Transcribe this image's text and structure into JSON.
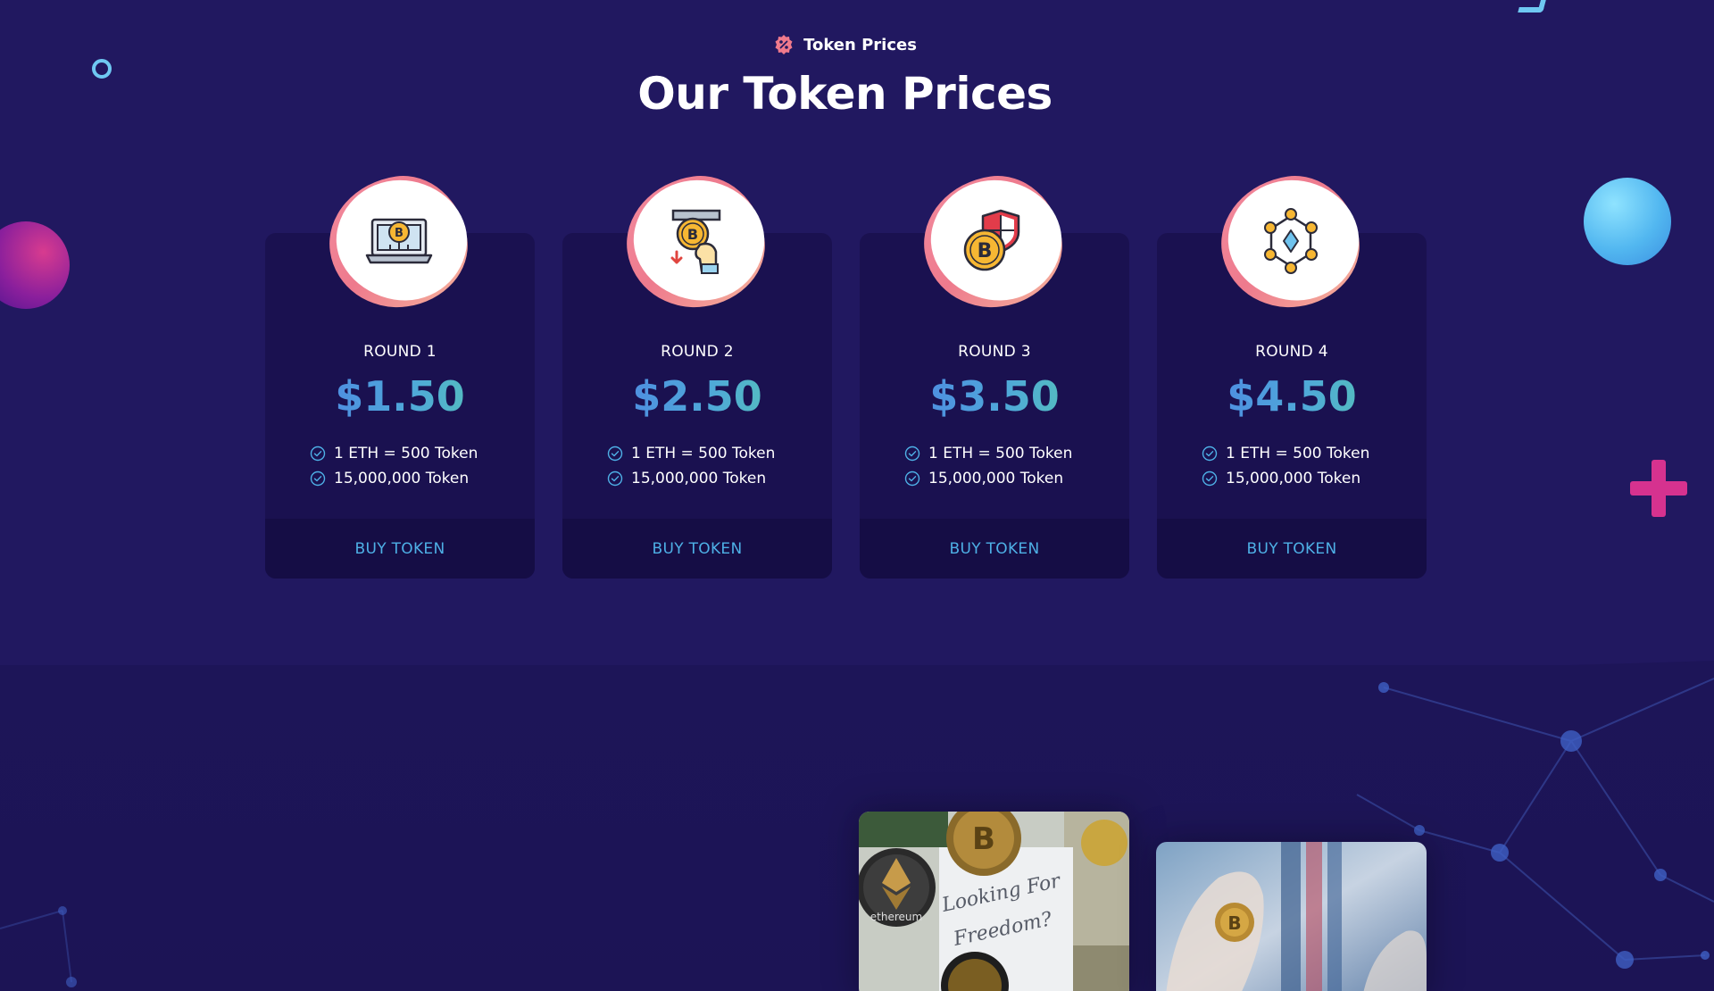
{
  "header": {
    "eyebrow": "Token Prices",
    "title": "Our Token Prices"
  },
  "cards": [
    {
      "round": "ROUND 1",
      "price": "$1.50",
      "features": [
        "1 ETH = 500 Token",
        "15,000,000 Token"
      ],
      "button": "BUY TOKEN",
      "icon": "bitcoin-laptop-icon"
    },
    {
      "round": "ROUND 2",
      "price": "$2.50",
      "features": [
        "1 ETH = 500 Token",
        "15,000,000 Token"
      ],
      "button": "BUY TOKEN",
      "icon": "bitcoin-atm-icon"
    },
    {
      "round": "ROUND 3",
      "price": "$3.50",
      "features": [
        "1 ETH = 500 Token",
        "15,000,000 Token"
      ],
      "button": "BUY TOKEN",
      "icon": "bitcoin-shield-icon"
    },
    {
      "round": "ROUND 4",
      "price": "$4.50",
      "features": [
        "1 ETH = 500 Token",
        "15,000,000 Token"
      ],
      "button": "BUY TOKEN",
      "icon": "ethereum-network-icon"
    }
  ],
  "photos": {
    "photo_1": {
      "handwriting_1": "Looking For",
      "handwriting_2": "Freedom?",
      "coin_label": "ethereum"
    }
  },
  "colors": {
    "background": "#211860",
    "card": "#1a1150",
    "card_footer": "#150d45",
    "button_text": "#4eb0e6",
    "price_gradient_start": "#4d7ae8",
    "price_gradient_end": "#59d0a6",
    "blob_pink": "#ee7a8d"
  }
}
